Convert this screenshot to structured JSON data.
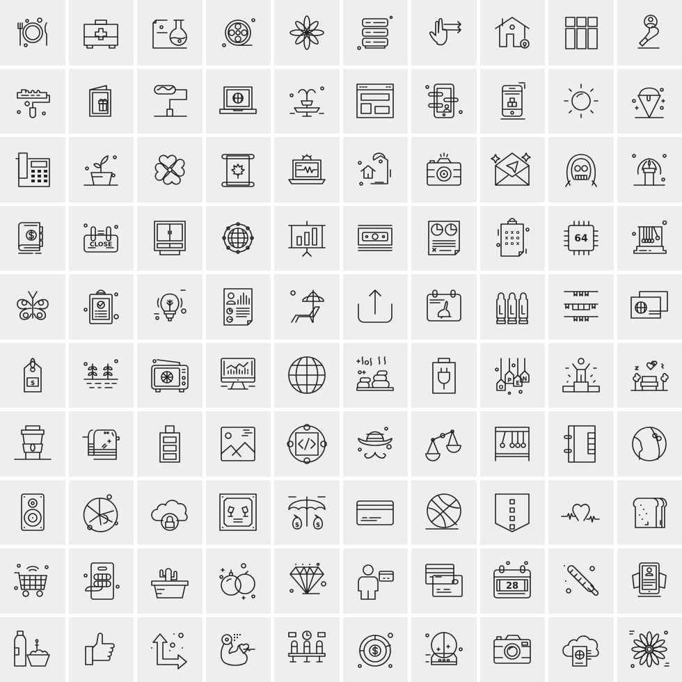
{
  "title": "Line icon set",
  "background": "#ffffff",
  "tile_color": "#eeeeee",
  "stroke_color": "#222222",
  "icons": [
    {
      "name": "dinner-plate-icon",
      "label": "Dinner plate with fork and knife"
    },
    {
      "name": "first-aid-kit-icon",
      "label": "First aid kit"
    },
    {
      "name": "lab-flask-document-icon",
      "label": "Document with lab flask"
    },
    {
      "name": "film-reel-icon",
      "label": "Film reel"
    },
    {
      "name": "flower-icon",
      "label": "Flower"
    },
    {
      "name": "server-rack-icon",
      "label": "Server rack"
    },
    {
      "name": "two-finger-swipe-icon",
      "label": "Two finger swipe right"
    },
    {
      "name": "home-location-icon",
      "label": "House with location pin"
    },
    {
      "name": "column-layout-icon",
      "label": "Three column layout"
    },
    {
      "name": "hand-search-user-icon",
      "label": "Hand holding user search"
    },
    {
      "name": "paint-roller-icon",
      "label": "Paint roller"
    },
    {
      "name": "gift-card-icon",
      "label": "Greeting card with gift"
    },
    {
      "name": "paint-roller-stand-icon",
      "label": "Paint roller on stand"
    },
    {
      "name": "laptop-globe-icon",
      "label": "Laptop with globe"
    },
    {
      "name": "fountain-icon",
      "label": "Fountain"
    },
    {
      "name": "browser-layout-icon",
      "label": "Browser window layout"
    },
    {
      "name": "mobile-app-sliders-icon",
      "label": "Mobile with sliders and user"
    },
    {
      "name": "mobile-boxes-icon",
      "label": "Mobile with boxes"
    },
    {
      "name": "sun-icon",
      "label": "Sun"
    },
    {
      "name": "ice-cream-cone-icon",
      "label": "Ice cream cone"
    },
    {
      "name": "office-phone-icon",
      "label": "Office telephone"
    },
    {
      "name": "potted-plant-icon",
      "label": "Potted plant"
    },
    {
      "name": "clover-flower-icon",
      "label": "Four-leaf flower"
    },
    {
      "name": "maple-leaf-scroll-icon",
      "label": "Scroll with maple leaf"
    },
    {
      "name": "laptop-pulse-settings-icon",
      "label": "Laptop with pulse and gear"
    },
    {
      "name": "house-price-tag-icon",
      "label": "House price tag"
    },
    {
      "name": "camera-icon",
      "label": "Camera"
    },
    {
      "name": "open-envelope-send-icon",
      "label": "Open envelope with paper plane"
    },
    {
      "name": "hooded-skull-icon",
      "label": "Hooded skull"
    },
    {
      "name": "candle-glow-icon",
      "label": "Candle"
    },
    {
      "name": "dollar-book-icon",
      "label": "Book with dollar"
    },
    {
      "name": "close-sign-icon",
      "label": "Close sign",
      "text": "CLOSE"
    },
    {
      "name": "cupboard-icon",
      "label": "Cupboard"
    },
    {
      "name": "globe-network-icon",
      "label": "Globe network"
    },
    {
      "name": "presentation-chart-icon",
      "label": "Presentation board with bar chart"
    },
    {
      "name": "money-bills-icon",
      "label": "Stack of money bills"
    },
    {
      "name": "pie-report-icon",
      "label": "Report with pie charts"
    },
    {
      "name": "tic-tac-toe-clipboard-icon",
      "label": "Clipboard with tic tac toe"
    },
    {
      "name": "cpu-64-icon",
      "label": "64-bit chip",
      "text": "64"
    },
    {
      "name": "newtons-cradle-icon",
      "label": "Newton's cradle"
    },
    {
      "name": "butterfly-icon",
      "label": "Butterfly"
    },
    {
      "name": "clipboard-check-icon",
      "label": "Clipboard with checkmark"
    },
    {
      "name": "eco-bulb-icon",
      "label": "Light bulb with plant"
    },
    {
      "name": "profile-report-icon",
      "label": "Profile report document"
    },
    {
      "name": "beach-chair-umbrella-icon",
      "label": "Beach chair with umbrella"
    },
    {
      "name": "upload-icon",
      "label": "Upload / share"
    },
    {
      "name": "easter-calendar-icon",
      "label": "Calendar with rabbit"
    },
    {
      "name": "cartridges-icon",
      "label": "Cartridges"
    },
    {
      "name": "party-bunting-icon",
      "label": "Party bunting flags"
    },
    {
      "name": "passport-globe-icon",
      "label": "Passport cards with globe"
    },
    {
      "name": "price-tag-dollar-icon",
      "label": "Price tag with dollar"
    },
    {
      "name": "sprouts-icon",
      "label": "Sprouts growing"
    },
    {
      "name": "retro-tv-icon",
      "label": "Retro TV with antenna"
    },
    {
      "name": "monitor-analytics-icon",
      "label": "Monitor with analytics"
    },
    {
      "name": "globe-icon",
      "label": "Globe"
    },
    {
      "name": "spa-stones-icon",
      "label": "Hot spa stones"
    },
    {
      "name": "battery-plug-icon",
      "label": "Battery with plug"
    },
    {
      "name": "open-tags-icon",
      "label": "Open hanging tags",
      "letters": [
        "O",
        "P",
        "E",
        "N"
      ]
    },
    {
      "name": "winner-podium-icon",
      "label": "Person on winner podium"
    },
    {
      "name": "park-bench-icon",
      "label": "Park bench with trees and hearts"
    },
    {
      "name": "coffee-cup-icon",
      "label": "Takeaway coffee cup"
    },
    {
      "name": "towel-icon",
      "label": "Towel on rack"
    },
    {
      "name": "battery-full-icon",
      "label": "Full battery"
    },
    {
      "name": "image-landscape-icon",
      "label": "Image with mountains"
    },
    {
      "name": "code-circle-icon",
      "label": "Code in circle"
    },
    {
      "name": "hat-mustache-icon",
      "label": "Bowler hat and mustache"
    },
    {
      "name": "balance-scale-icon",
      "label": "Balance scale"
    },
    {
      "name": "pendulum-frame-icon",
      "label": "Pendulum frame"
    },
    {
      "name": "notebook-binder-icon",
      "label": "Binder notebook"
    },
    {
      "name": "planet-icon",
      "label": "Planet"
    },
    {
      "name": "speaker-icon",
      "label": "Speaker"
    },
    {
      "name": "pie-chart-dots-icon",
      "label": "Pie chart"
    },
    {
      "name": "cloud-lock-icon",
      "label": "Cloud with lock"
    },
    {
      "name": "framed-toast-icon",
      "label": "Framed picture with glasses toast"
    },
    {
      "name": "umbrella-money-icon",
      "label": "Umbrella protecting money bags"
    },
    {
      "name": "credit-card-icon",
      "label": "Credit card"
    },
    {
      "name": "basketball-icon",
      "label": "Basketball"
    },
    {
      "name": "pocket-shield-icon",
      "label": "Pocket / shield with buttons"
    },
    {
      "name": "heartbeat-icon",
      "label": "Heart with heartbeat"
    },
    {
      "name": "bread-icon",
      "label": "Bread slices"
    },
    {
      "name": "smart-cart-icon",
      "label": "Shopping cart with wifi"
    },
    {
      "name": "slot-machine-icon",
      "label": "Slot machine"
    },
    {
      "name": "cactus-pot-icon",
      "label": "Cactus in pot"
    },
    {
      "name": "bombs-icon",
      "label": "Bombs"
    },
    {
      "name": "diamond-icon",
      "label": "Diamond"
    },
    {
      "name": "user-card-icon",
      "label": "User with card"
    },
    {
      "name": "credit-cards-icon",
      "label": "Credit cards"
    },
    {
      "name": "calendar-28-icon",
      "label": "Calendar day 28",
      "text": "28"
    },
    {
      "name": "popsicle-icon",
      "label": "Popsicle"
    },
    {
      "name": "tablet-profile-icon",
      "label": "Hands holding tablet with profile"
    },
    {
      "name": "cleaning-supplies-icon",
      "label": "Bottle and bucket cleaning supplies"
    },
    {
      "name": "thumbs-up-icon",
      "label": "Thumbs up"
    },
    {
      "name": "direction-arrows-icon",
      "label": "Up and right arrows"
    },
    {
      "name": "fitness-heart-icon",
      "label": "Arm with dumbbell and heart"
    },
    {
      "name": "waiting-room-icon",
      "label": "Waiting room seats with clock"
    },
    {
      "name": "dollar-target-icon",
      "label": "Dollar target"
    },
    {
      "name": "snow-globe-icon",
      "label": "Snow globe"
    },
    {
      "name": "camera-alt-icon",
      "label": "Camera"
    },
    {
      "name": "cloud-passport-icon",
      "label": "Cloud with passport"
    },
    {
      "name": "sunflower-icon",
      "label": "Sunflower"
    }
  ]
}
